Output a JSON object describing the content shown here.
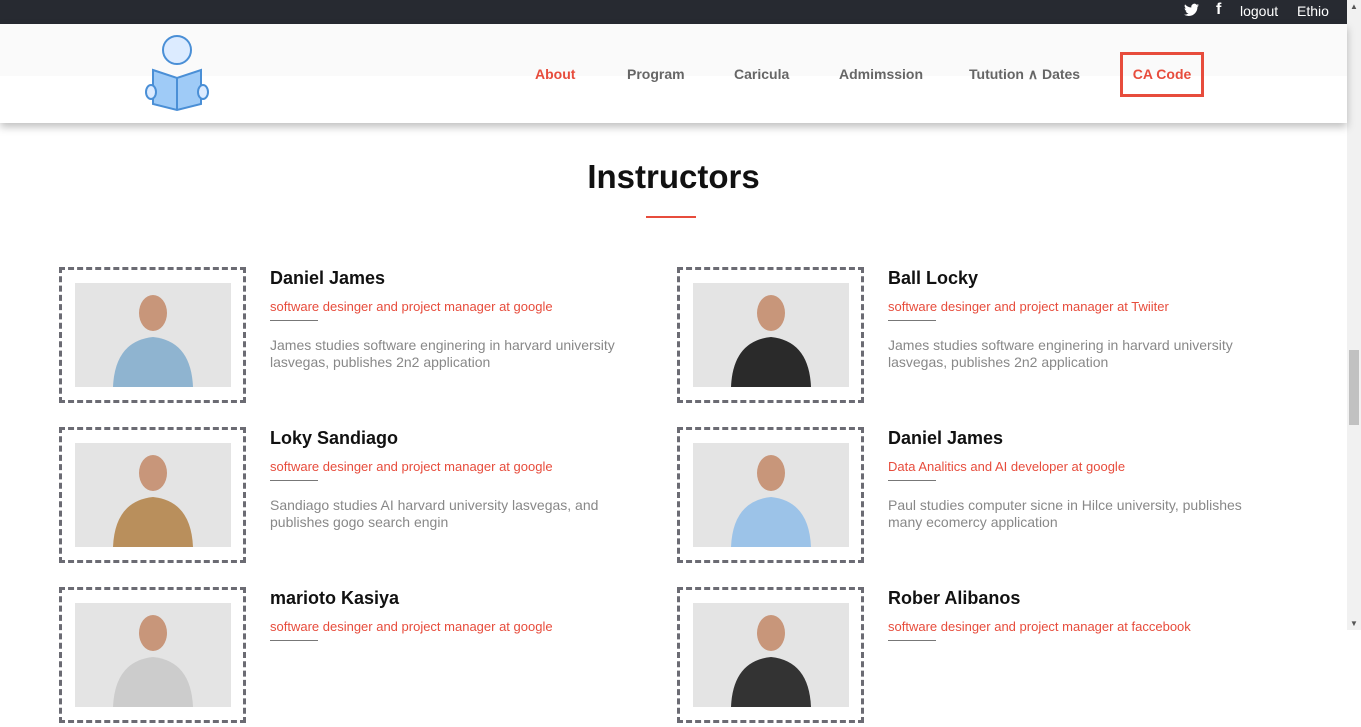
{
  "topbar": {
    "twitter_icon": "twitter-icon",
    "facebook_icon": "facebook-icon",
    "logout": "logout",
    "language": "Ethio"
  },
  "nav": {
    "items": [
      "About",
      "Program",
      "Caricula",
      "Admimssion",
      "Tutution ∧ Dates"
    ],
    "cta": "CA Code",
    "accent": "#e74c3c"
  },
  "section": {
    "title": "Instructors"
  },
  "instructors": [
    {
      "name": "Daniel James",
      "role": "software desinger and project manager at google",
      "bio": "James studies software enginering in harvard university lasvegas, publishes 2n2 application"
    },
    {
      "name": "Ball Locky",
      "role": "software desinger and project manager at Twiiter",
      "bio": "James studies software enginering in harvard university lasvegas, publishes 2n2 application"
    },
    {
      "name": "Loky Sandiago",
      "role": "software desinger and project manager at google",
      "bio": "Sandiago studies AI harvard university lasvegas, and publishes gogo search engin"
    },
    {
      "name": "Daniel James",
      "role": "Data Analitics and AI developer at google",
      "bio": "Paul studies computer sicne in Hilce university, publishes many ecomercy application"
    },
    {
      "name": "marioto Kasiya",
      "role": "software desinger and project manager at google",
      "bio": ""
    },
    {
      "name": "Rober Alibanos",
      "role": "software desinger and project manager at faccebook",
      "bio": ""
    }
  ]
}
